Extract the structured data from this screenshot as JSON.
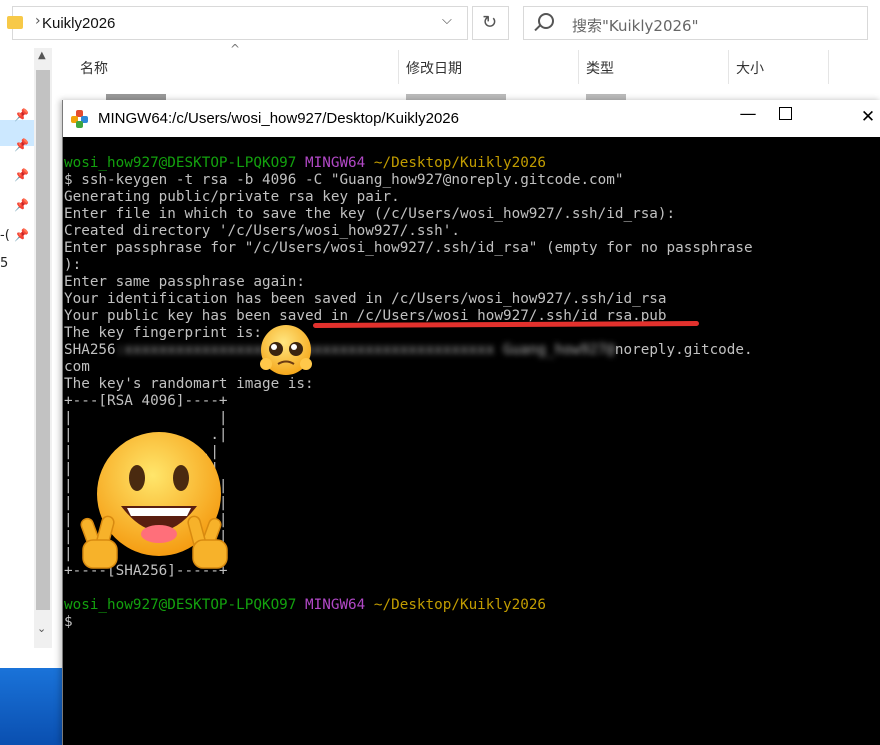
{
  "explorer": {
    "breadcrumb": "Kuikly2026",
    "search_placeholder": "搜索\"Kuikly2026\"",
    "columns": {
      "name": "名称",
      "modified": "修改日期",
      "type": "类型",
      "size": "大小"
    },
    "nav_fragments": [
      "-(",
      "5"
    ]
  },
  "terminal": {
    "title": "MINGW64:/c/Users/wosi_how927/Desktop/Kuikly2026",
    "prompt_user": "wosi_how927@DESKTOP-LPQKO97",
    "prompt_env": "MINGW64",
    "prompt_path": "~/Desktop/Kuikly2026",
    "command": "$ ssh-keygen -t rsa -b 4096 -C \"Guang_how927@noreply.gitcode.com\"",
    "output_lines": [
      "Generating public/private rsa key pair.",
      "Enter file in which to save the key (/c/Users/wosi_how927/.ssh/id_rsa):",
      "Created directory '/c/Users/wosi_how927/.ssh'.",
      "Enter passphrase for \"/c/Users/wosi_how927/.ssh/id_rsa\" (empty for no passphrase",
      "):",
      "Enter same passphrase again:",
      "Your identification has been saved in /c/Users/wosi_how927/.ssh/id_rsa",
      "Your public key has been saved in /c/Users/wosi_how927/.ssh/id_rsa.pub",
      "The key fingerprint is:"
    ],
    "fingerprint_prefix": "SHA256",
    "fingerprint_redacted": ":xxxxxxxxxxxxxxxxxxxxxxxxxxxxxxxxxxxxxxxxxxx Guang_how927@",
    "fingerprint_suffix": "noreply.gitcode.",
    "fingerprint_wrap": "com",
    "randomart_header": "The key's randomart image is:",
    "randomart_top": "+---[RSA 4096]----+",
    "randomart_rows": [
      "|                 |",
      "|                .|",
      "|               .|",
      "|                |",
      "|                 |",
      "|                 |",
      "|                 |",
      "|                 |",
      "|                 |"
    ],
    "randomart_bottom": "+----[SHA256]-----+",
    "final_prompt": "$",
    "colors": {
      "user": "#13a10e",
      "env": "#b148c6",
      "path": "#c19c00",
      "text": "#c0c0c0",
      "background": "#000000",
      "underline": "#e2312d"
    },
    "window_controls": {
      "minimize": "—",
      "close": "✕"
    }
  }
}
